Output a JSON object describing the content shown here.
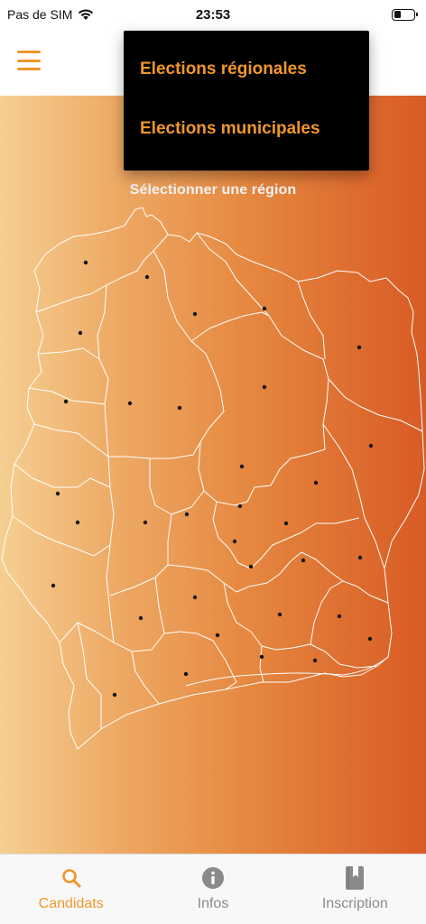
{
  "status_bar": {
    "carrier": "Pas de SIM",
    "time": "23:53",
    "battery_level": 0.35
  },
  "header": {
    "menu_icon": "hamburger-menu-icon"
  },
  "dropdown": {
    "items": [
      {
        "label": "Elections régionales"
      },
      {
        "label": "Elections municipales"
      }
    ]
  },
  "map": {
    "prompt": "Sélectionner une région"
  },
  "tab_bar": {
    "tabs": [
      {
        "label": "Candidats",
        "icon": "search-icon",
        "active": true
      },
      {
        "label": "Infos",
        "icon": "info-icon",
        "active": false
      },
      {
        "label": "Inscription",
        "icon": "bookmark-book-icon",
        "active": false
      }
    ]
  },
  "colors": {
    "accent": "#f0972a",
    "gradient_start": "#f6cf92",
    "gradient_end": "#d85b25",
    "dropdown_bg": "#000000",
    "tab_inactive": "#8a8a8a"
  }
}
